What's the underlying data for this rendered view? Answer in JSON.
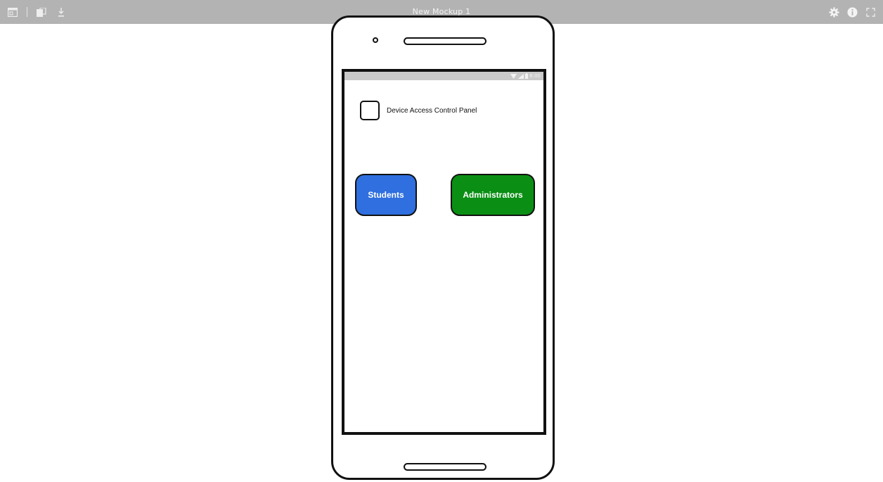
{
  "window": {
    "title": "New Mockup 1"
  },
  "toolbar": {
    "left_icons": [
      "window-icon",
      "copy-icon",
      "download-icon"
    ],
    "right_icons": [
      "gear-icon",
      "info-icon",
      "fullscreen-icon"
    ]
  },
  "phone": {
    "status_bar": {
      "time": "6:00"
    },
    "checkbox": {
      "label": "Device Access Control Panel",
      "checked": false
    },
    "buttons": {
      "students": {
        "label": "Students",
        "color": "#2f6fdf"
      },
      "administrators": {
        "label": "Administrators",
        "color": "#0a8f14"
      }
    }
  },
  "colors": {
    "toolbar_bg": "#b3b3b3",
    "frame": "#111111"
  }
}
